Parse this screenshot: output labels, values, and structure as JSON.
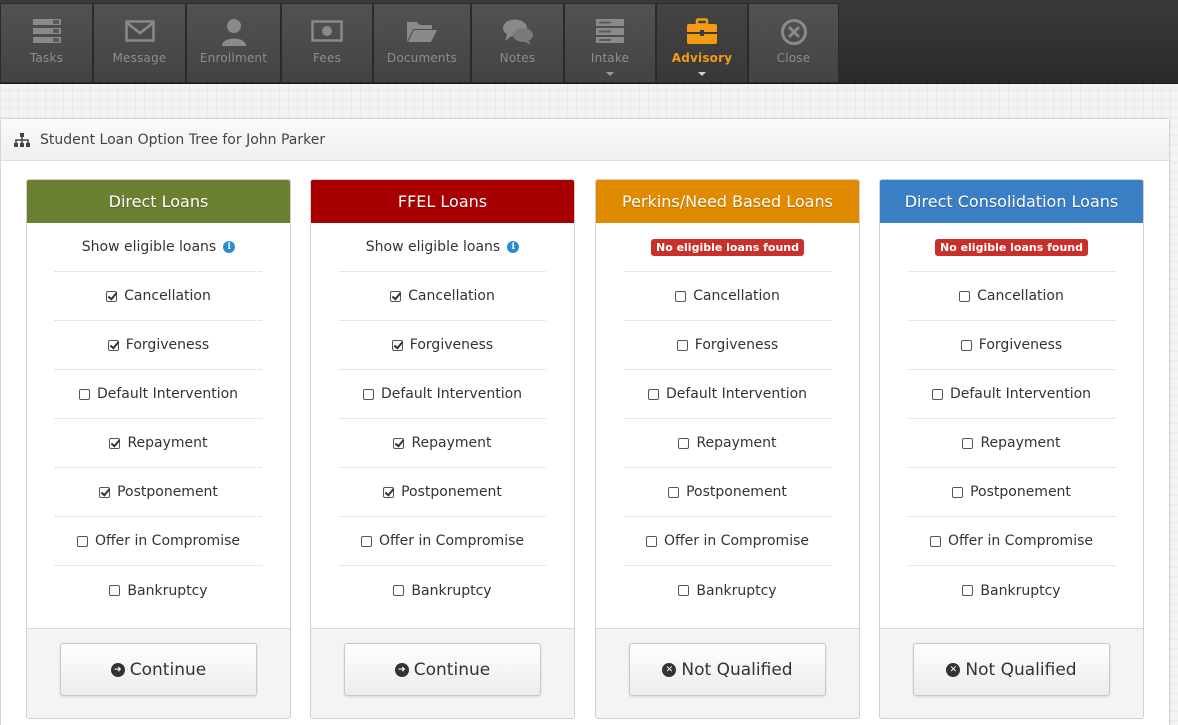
{
  "toolbar": {
    "items": [
      {
        "label": "Tasks",
        "icon": "tasks-icon"
      },
      {
        "label": "Message",
        "icon": "envelope-icon"
      },
      {
        "label": "Enrollment",
        "icon": "user-icon"
      },
      {
        "label": "Fees",
        "icon": "money-icon"
      },
      {
        "label": "Documents",
        "icon": "folder-icon"
      },
      {
        "label": "Notes",
        "icon": "comments-icon"
      },
      {
        "label": "Intake",
        "icon": "server-icon"
      },
      {
        "label": "Advisory",
        "icon": "briefcase-icon"
      },
      {
        "label": "Close",
        "icon": "close-circle-icon"
      }
    ],
    "active": "Advisory",
    "active_color": "#f39c12"
  },
  "panel": {
    "title": "Student Loan Option Tree for John Parker",
    "icon": "sitemap-icon"
  },
  "columns": [
    {
      "title": "Direct Loans",
      "color": "#6b8131",
      "eligible_text": "Show eligible loans",
      "eligible_icon": "info-icon",
      "options": [
        {
          "label": "Cancellation",
          "checked": true
        },
        {
          "label": "Forgiveness",
          "checked": true
        },
        {
          "label": "Default Intervention",
          "checked": false
        },
        {
          "label": "Repayment",
          "checked": true
        },
        {
          "label": "Postponement",
          "checked": true
        },
        {
          "label": "Offer in Compromise",
          "checked": false
        },
        {
          "label": "Bankruptcy",
          "checked": false
        }
      ],
      "button_label": "Continue",
      "button_icon": "arrow-circle-right-icon"
    },
    {
      "title": "FFEL Loans",
      "color": "#a80000",
      "eligible_text": "Show eligible loans",
      "eligible_icon": "info-icon",
      "options": [
        {
          "label": "Cancellation",
          "checked": true
        },
        {
          "label": "Forgiveness",
          "checked": true
        },
        {
          "label": "Default Intervention",
          "checked": false
        },
        {
          "label": "Repayment",
          "checked": true
        },
        {
          "label": "Postponement",
          "checked": true
        },
        {
          "label": "Offer in Compromise",
          "checked": false
        },
        {
          "label": "Bankruptcy",
          "checked": false
        }
      ],
      "button_label": "Continue",
      "button_icon": "arrow-circle-right-icon"
    },
    {
      "title": "Perkins/Need Based Loans",
      "color": "#e08a00",
      "badge": "No eligible loans found",
      "options": [
        {
          "label": "Cancellation",
          "checked": false
        },
        {
          "label": "Forgiveness",
          "checked": false
        },
        {
          "label": "Default Intervention",
          "checked": false
        },
        {
          "label": "Repayment",
          "checked": false
        },
        {
          "label": "Postponement",
          "checked": false
        },
        {
          "label": "Offer in Compromise",
          "checked": false
        },
        {
          "label": "Bankruptcy",
          "checked": false
        }
      ],
      "button_label": "Not Qualified",
      "button_icon": "times-circle-icon"
    },
    {
      "title": "Direct Consolidation Loans",
      "color": "#3a7fc4",
      "badge": "No eligible loans found",
      "options": [
        {
          "label": "Cancellation",
          "checked": false
        },
        {
          "label": "Forgiveness",
          "checked": false
        },
        {
          "label": "Default Intervention",
          "checked": false
        },
        {
          "label": "Repayment",
          "checked": false
        },
        {
          "label": "Postponement",
          "checked": false
        },
        {
          "label": "Offer in Compromise",
          "checked": false
        },
        {
          "label": "Bankruptcy",
          "checked": false
        }
      ],
      "button_label": "Not Qualified",
      "button_icon": "times-circle-icon"
    }
  ]
}
